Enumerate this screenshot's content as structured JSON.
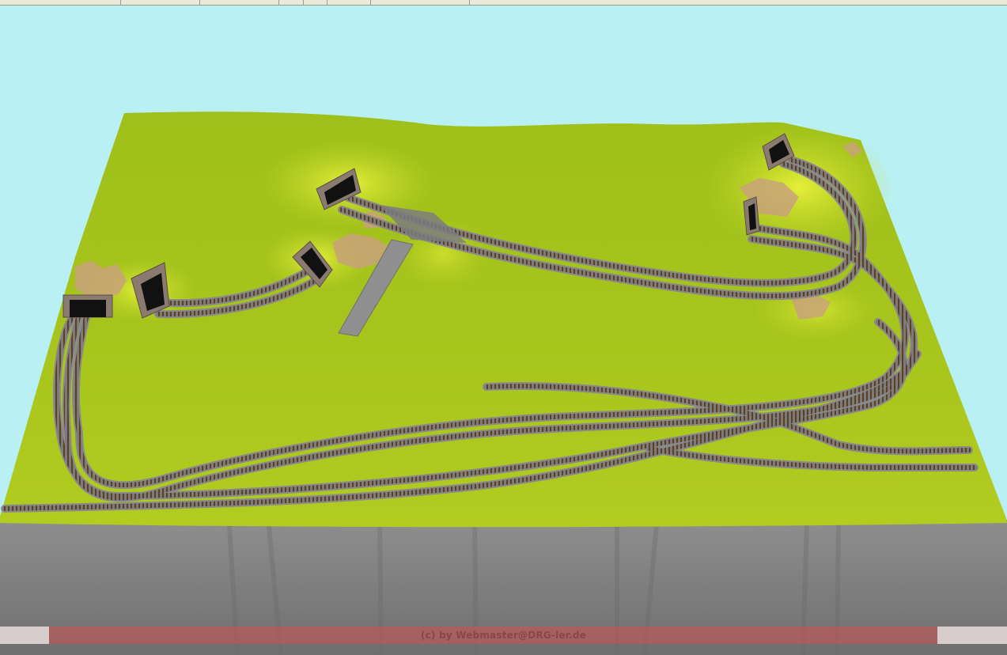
{
  "toolbar": {
    "background": "#ece9d8"
  },
  "scene": {
    "background": "#b9f0f3",
    "ground_color": "#a8c41a",
    "ground_highlight": "#d6e62a",
    "track_ballast": "#8c8c8c",
    "track_ties": "#6e4a2a",
    "base_side": "#9a9a9a",
    "tunnel_portal": "stone"
  },
  "watermark": {
    "text": "(c) by Webmaster@DRG-ler.de",
    "color": "#cc4f4f"
  }
}
